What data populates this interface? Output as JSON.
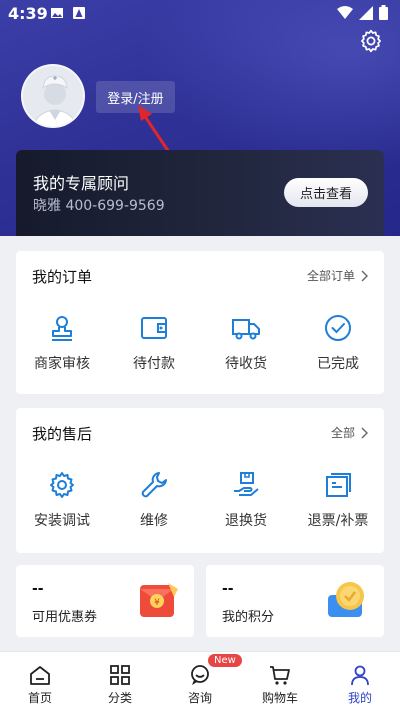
{
  "status_bar": {
    "time": "4:39"
  },
  "profile": {
    "login_label": "登录/注册"
  },
  "advisor": {
    "title": "我的专属顾问",
    "contact": "晓雅 400-699-9569",
    "view_label": "点击查看"
  },
  "orders": {
    "title": "我的订单",
    "more_label": "全部订单",
    "items": [
      {
        "label": "商家审核",
        "icon": "merchant-review-icon"
      },
      {
        "label": "待付款",
        "icon": "wallet-icon"
      },
      {
        "label": "待收货",
        "icon": "truck-icon"
      },
      {
        "label": "已完成",
        "icon": "check-circle-icon"
      }
    ]
  },
  "after_sales": {
    "title": "我的售后",
    "more_label": "全部",
    "items": [
      {
        "label": "安装调试",
        "icon": "install-gear-icon"
      },
      {
        "label": "维修",
        "icon": "wrench-icon"
      },
      {
        "label": "退换货",
        "icon": "return-box-icon"
      },
      {
        "label": "退票/补票",
        "icon": "invoice-icon"
      }
    ]
  },
  "coupons": {
    "value": "--",
    "label": "可用优惠券"
  },
  "points": {
    "value": "--",
    "label": "我的积分"
  },
  "tabs": [
    {
      "label": "首页",
      "icon": "home-icon"
    },
    {
      "label": "分类",
      "icon": "grid-icon"
    },
    {
      "label": "咨询",
      "icon": "chat-icon",
      "badge": "New"
    },
    {
      "label": "购物车",
      "icon": "cart-icon"
    },
    {
      "label": "我的",
      "icon": "person-icon",
      "active": true
    }
  ],
  "colors": {
    "header": "#2f3196",
    "accent": "#1f7fd8",
    "active_tab": "#2f43c8",
    "badge": "#e84545"
  }
}
